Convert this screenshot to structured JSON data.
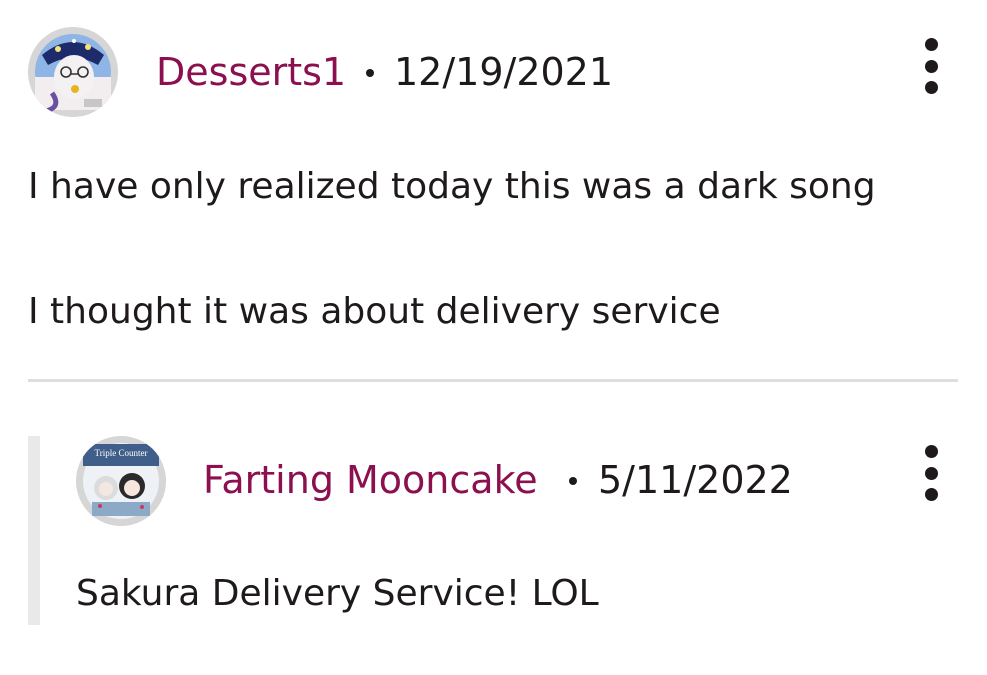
{
  "comment": {
    "author": "Desserts1",
    "date": "12/19/2021",
    "avatar_icon": "avatar-desserts1-icon",
    "more_icon": "more-vertical-icon",
    "lines": [
      "I have only realized today this was a dark song",
      "I thought it was about delivery service"
    ]
  },
  "reply": {
    "author": "Farting Mooncake",
    "date": "5/11/2022",
    "avatar_icon": "avatar-farting-mooncake-icon",
    "avatar_text": "Triple Counter",
    "more_icon": "more-vertical-icon",
    "text": "Sakura Delivery Service! LOL"
  },
  "colors": {
    "author": "#8c0f4f",
    "text": "#1e1a1c",
    "divider": "#dedede",
    "rail": "#e9e9e9"
  }
}
